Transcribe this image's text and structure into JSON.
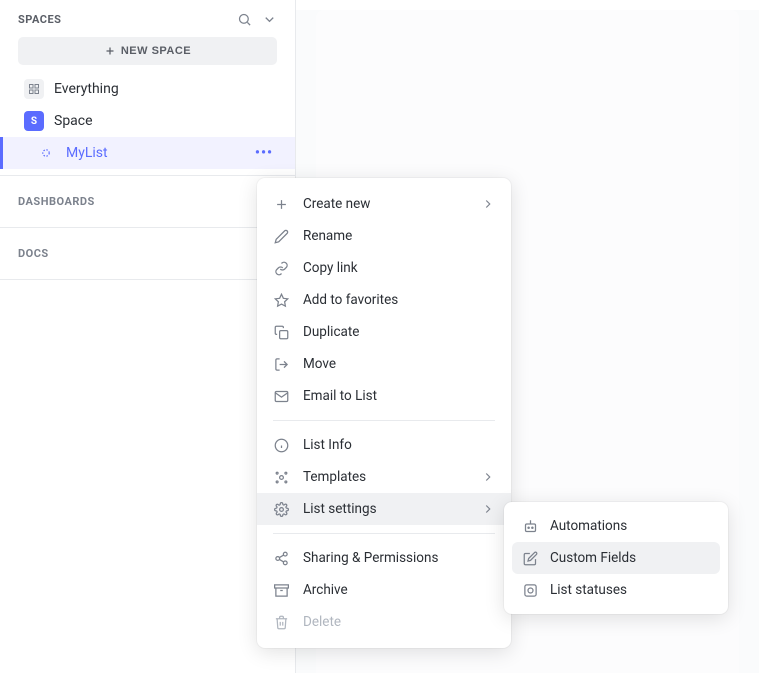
{
  "sidebar": {
    "spaces_label": "SPACES",
    "new_space_label": "NEW SPACE",
    "items": [
      {
        "label": "Everything"
      },
      {
        "label": "Space",
        "badge": "S"
      },
      {
        "label": "MyList"
      }
    ],
    "dashboards_label": "DASHBOARDS",
    "docs_label": "DOCS"
  },
  "context_menu": {
    "create_new": "Create new",
    "rename": "Rename",
    "copy_link": "Copy link",
    "add_favorites": "Add to favorites",
    "duplicate": "Duplicate",
    "move": "Move",
    "email_list": "Email to List",
    "list_info": "List Info",
    "templates": "Templates",
    "list_settings": "List settings",
    "sharing": "Sharing & Permissions",
    "archive": "Archive",
    "delete": "Delete"
  },
  "submenu": {
    "automations": "Automations",
    "custom_fields": "Custom Fields",
    "list_statuses": "List statuses"
  }
}
